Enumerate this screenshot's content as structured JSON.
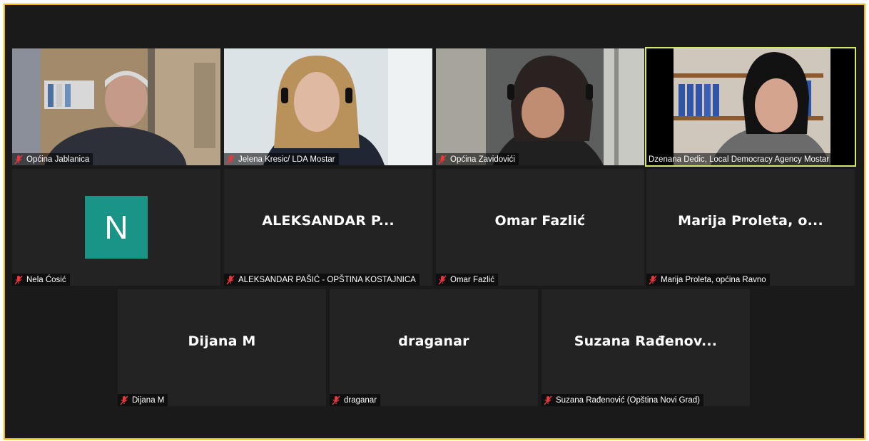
{
  "colors": {
    "frame_border": "#f5b400",
    "active_speaker": "#d6e86a",
    "avatar_bg": "#199487",
    "muted_icon": "#e8383d"
  },
  "participants": [
    {
      "label": "Općina Jablanica",
      "video": true,
      "muted": true
    },
    {
      "label": "Jelena Kresic/ LDA Mostar",
      "video": true,
      "muted": true
    },
    {
      "label": "Općina Zavidovići",
      "video": true,
      "muted": true
    },
    {
      "label": "Dzenana Dedic, Local Democracy Agency Mostar",
      "video": true,
      "muted": false,
      "active": true
    },
    {
      "label": "Nela Ćosić",
      "avatar_letter": "N",
      "muted": true
    },
    {
      "label": "ALEKSANDAR PAŠIĆ - OPŠTINA KOSTAJNICA",
      "display": "ALEKSANDAR  P...",
      "muted": true
    },
    {
      "label": "Omar Fazlić",
      "display": "Omar Fazlić",
      "muted": true
    },
    {
      "label": "Marija Proleta, općina Ravno",
      "display": "Marija Proleta,  o...",
      "muted": true
    },
    {
      "label": "Dijana M",
      "display": "Dijana M",
      "muted": true
    },
    {
      "label": "draganar",
      "display": "draganar",
      "muted": true
    },
    {
      "label": "Suzana Rađenović (Opština Novi Grad)",
      "display": "Suzana  Rađenov...",
      "muted": true
    }
  ]
}
